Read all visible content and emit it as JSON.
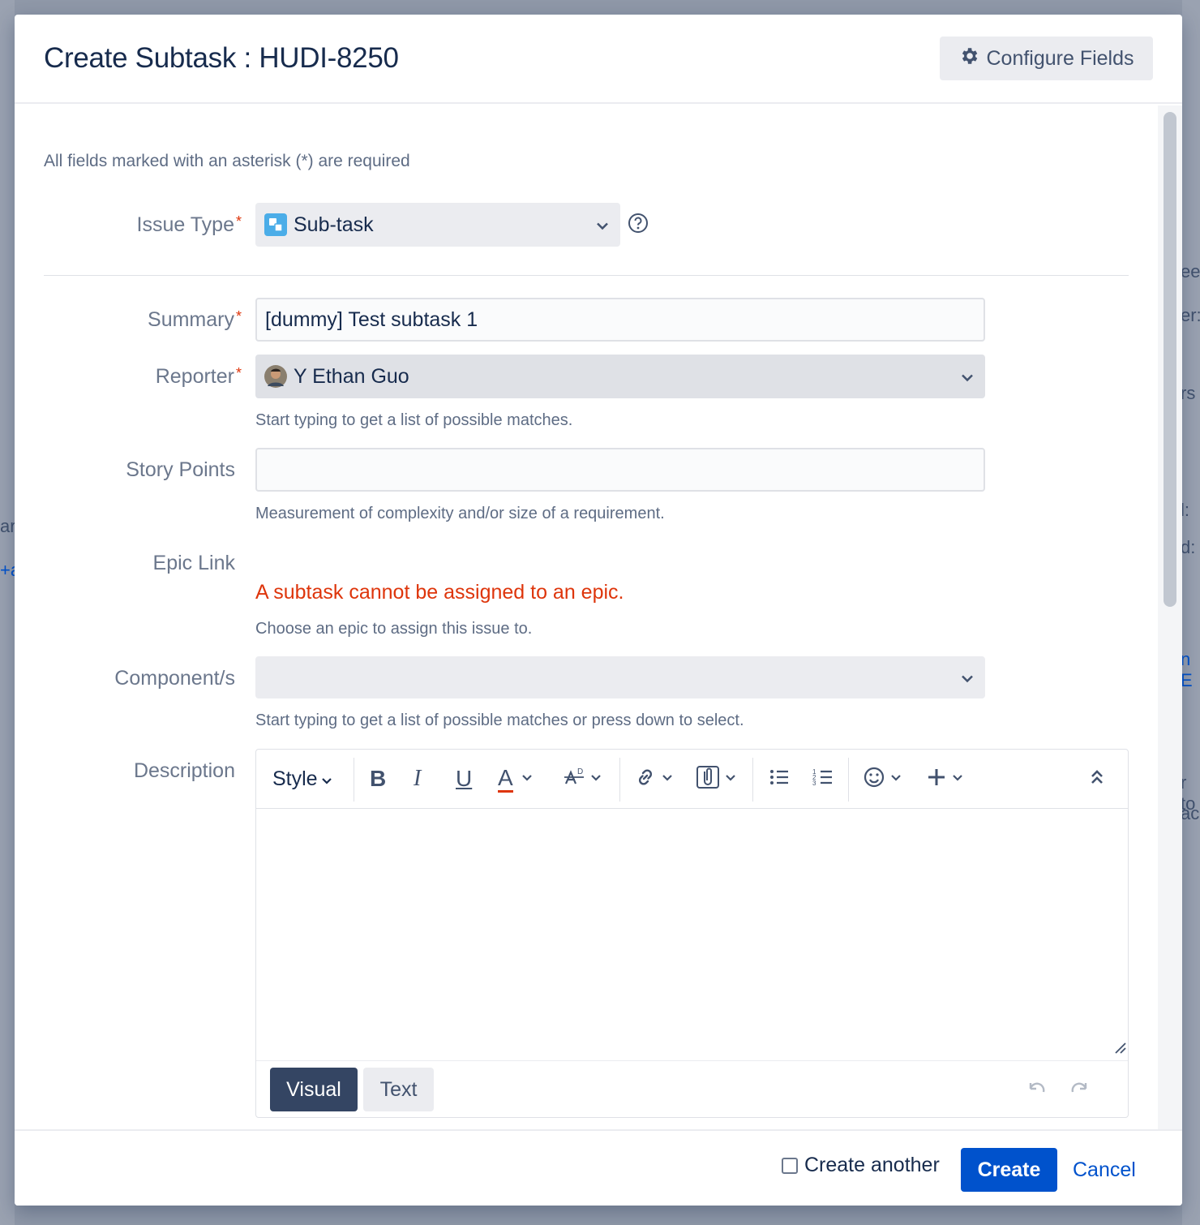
{
  "background": {
    "fragments": [
      "ar",
      "+a",
      "ee",
      "er:",
      "rs",
      "l:",
      "d:",
      "n E",
      "r to",
      "ac"
    ]
  },
  "dialog": {
    "title": "Create Subtask : HUDI-8250",
    "configure_fields_label": "Configure Fields",
    "required_note": "All fields marked with an asterisk (*) are required",
    "required_star": "*",
    "issue_type": {
      "label": "Issue Type",
      "value": "Sub-task"
    },
    "summary": {
      "label": "Summary",
      "value": "[dummy] Test subtask 1"
    },
    "reporter": {
      "label": "Reporter",
      "value": "Y Ethan Guo",
      "hint": "Start typing to get a list of possible matches."
    },
    "story_points": {
      "label": "Story Points",
      "value": "",
      "hint": "Measurement of complexity and/or size of a requirement."
    },
    "epic_link": {
      "label": "Epic Link",
      "error": "A subtask cannot be assigned to an epic.",
      "hint": "Choose an epic to assign this issue to."
    },
    "components": {
      "label": "Component/s",
      "value": "",
      "hint": "Start typing to get a list of possible matches or press down to select."
    },
    "description": {
      "label": "Description",
      "toolbar": {
        "style_label": "Style",
        "bold": "B",
        "italic": "I",
        "underline": "U",
        "text_color": "A"
      },
      "mode_visual": "Visual",
      "mode_text": "Text"
    },
    "footer": {
      "create_another_label": "Create another",
      "create_another_checked": false,
      "create_label": "Create",
      "cancel_label": "Cancel"
    }
  },
  "colors": {
    "primary": "#0052cc",
    "error": "#de350b",
    "text_color_underline": "#de350b",
    "visual_active": "#344563"
  }
}
